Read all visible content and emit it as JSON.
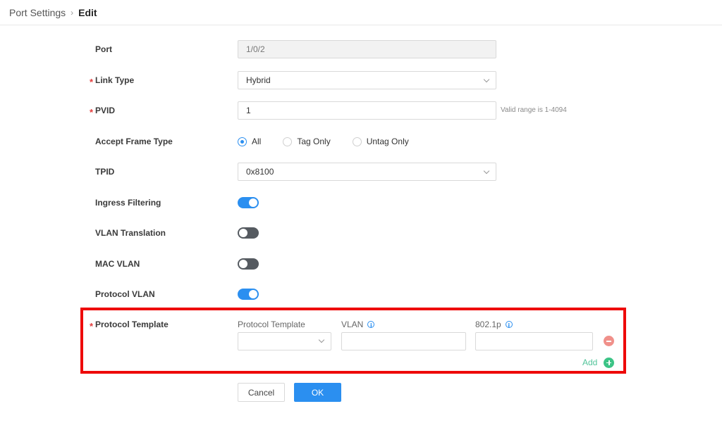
{
  "breadcrumb": {
    "parent": "Port Settings",
    "separator": "›",
    "current": "Edit"
  },
  "form": {
    "port": {
      "label": "Port",
      "value": "1/0/2"
    },
    "link_type": {
      "label": "Link Type",
      "value": "Hybrid"
    },
    "pvid": {
      "label": "PVID",
      "value": "1",
      "hint": "Valid range is 1-4094"
    },
    "accept_frame_type": {
      "label": "Accept Frame Type",
      "options": [
        "All",
        "Tag Only",
        "Untag Only"
      ],
      "selected": "All"
    },
    "tpid": {
      "label": "TPID",
      "value": "0x8100"
    },
    "ingress_filtering": {
      "label": "Ingress Filtering",
      "enabled": true
    },
    "vlan_translation": {
      "label": "VLAN Translation",
      "enabled": false
    },
    "mac_vlan": {
      "label": "MAC VLAN",
      "enabled": false
    },
    "protocol_vlan": {
      "label": "Protocol VLAN",
      "enabled": true
    },
    "protocol_template": {
      "label": "Protocol Template",
      "columns": {
        "protocol_template": "Protocol Template",
        "vlan": "VLAN",
        "priority": "802.1p"
      },
      "rows": [
        {
          "protocol_template": "",
          "vlan": "",
          "priority": ""
        }
      ],
      "add_label": "Add"
    }
  },
  "buttons": {
    "cancel": "Cancel",
    "ok": "OK"
  },
  "colors": {
    "accent": "#2b8ff0",
    "required": "#e23b3b",
    "highlight_box": "#ee0a0a",
    "add": "#3cc486",
    "remove": "#f0908a"
  },
  "icons": {
    "breadcrumb_separator": "chevron-right-icon",
    "select": "chevron-down-icon",
    "info": "info-icon",
    "remove": "minus-circle-icon",
    "add": "plus-circle-icon"
  }
}
